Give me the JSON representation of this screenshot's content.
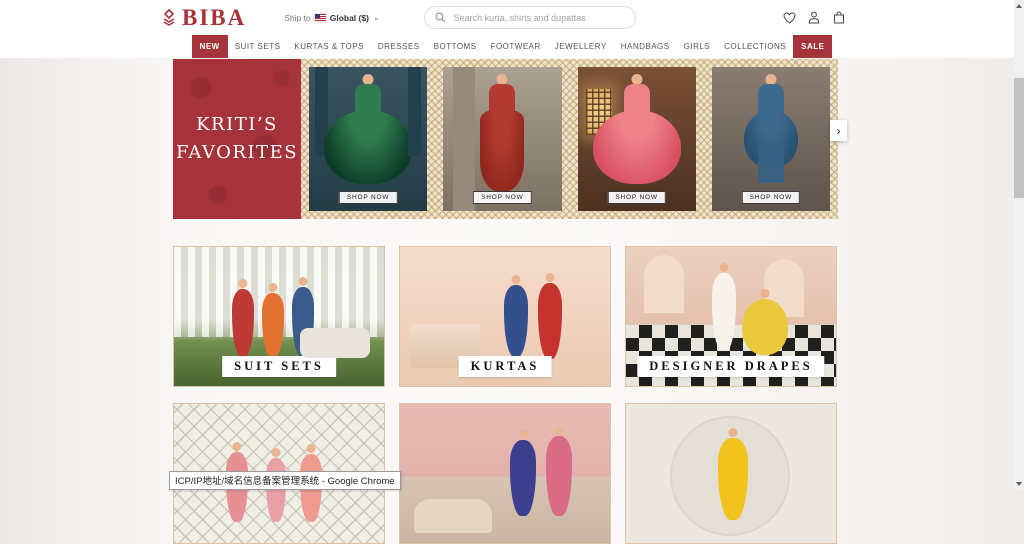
{
  "header": {
    "logo_text": "BIBA",
    "ship_to_label": "Ship to",
    "region_label": "Global ($)",
    "search_placeholder": "Search kurta, shirts and dupattas"
  },
  "nav": {
    "items": [
      {
        "label": "NEW",
        "highlighted": true
      },
      {
        "label": "SUIT SETS"
      },
      {
        "label": "KURTAS & TOPS"
      },
      {
        "label": "DRESSES"
      },
      {
        "label": "BOTTOMS"
      },
      {
        "label": "FOOTWEAR"
      },
      {
        "label": "JEWELLERY"
      },
      {
        "label": "HANDBAGS"
      },
      {
        "label": "GIRLS"
      },
      {
        "label": "COLLECTIONS"
      },
      {
        "label": "SALE",
        "highlighted": true
      }
    ]
  },
  "hero": {
    "panel": {
      "line1": "KRITI’S",
      "line2": "FAVORITES"
    },
    "slides": [
      {
        "photo": "model-in-green-flared-anarkali",
        "shop_label": "SHOP NOW"
      },
      {
        "photo": "model-in-red-kurta-with-dupatta",
        "shop_label": "SHOP NOW"
      },
      {
        "photo": "model-in-pink-flowing-lehenga",
        "shop_label": "SHOP NOW"
      },
      {
        "photo": "model-in-blue-kurta-set",
        "shop_label": "SHOP NOW"
      }
    ],
    "next_arrow": "›"
  },
  "categories": {
    "row1": [
      {
        "label": "SUIT SETS",
        "photo": "three-women-in-suit-sets-garden"
      },
      {
        "label": "KURTAS",
        "photo": "two-women-in-kurtas-peach-wall"
      },
      {
        "label": "DESIGNER DRAPES",
        "photo": "two-women-palace-checkered-floor"
      }
    ],
    "row2": [
      {
        "photo": "three-girls-in-pink-outfits-lattice"
      },
      {
        "photo": "two-women-festive-pink-room"
      },
      {
        "photo": "woman-in-yellow-kurta"
      }
    ]
  },
  "tooltip": {
    "text": "ICP/IP地址/域名信息备案管理系统 - Google Chrome"
  },
  "colors": {
    "brand_red": "#a5343a",
    "logo_red": "#a93338",
    "gold_frame": "#b2904a",
    "frame_cream": "#eee4cf",
    "nav_text": "#555555"
  }
}
